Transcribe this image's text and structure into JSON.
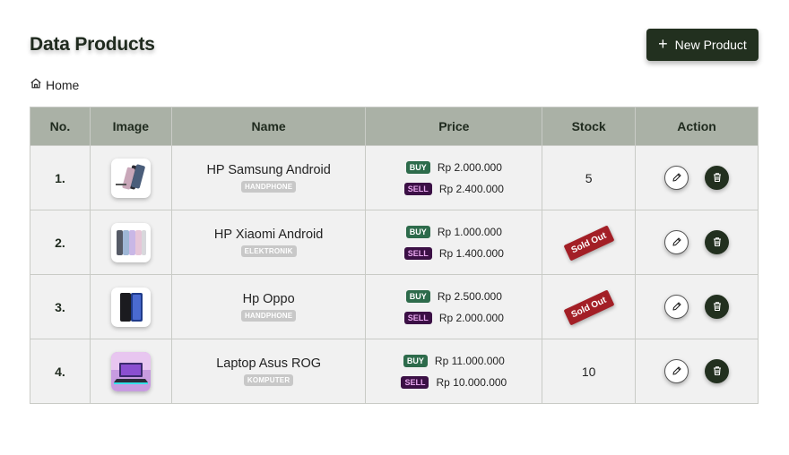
{
  "header": {
    "title": "Data Products",
    "new_button_icon": "plus-icon",
    "new_button_label": "New Product"
  },
  "breadcrumb": {
    "icon": "home-icon",
    "label": "Home"
  },
  "table": {
    "columns": [
      "No.",
      "Image",
      "Name",
      "Price",
      "Stock",
      "Action"
    ],
    "buy_label": "BUY",
    "sell_label": "SELL",
    "rows": [
      {
        "no": "1.",
        "image": "samsung-phones",
        "name": "HP Samsung Android",
        "category": "HANDPHONE",
        "buy": "Rp 2.000.000",
        "sell": "Rp 2.400.000",
        "stock": "5"
      },
      {
        "no": "2.",
        "image": "xiaomi-phones",
        "name": "HP Xiaomi Android",
        "category": "ELEKTRONIK",
        "buy": "Rp 1.000.000",
        "sell": "Rp 1.400.000",
        "stock": "Sold Out"
      },
      {
        "no": "3.",
        "image": "oppo-phone",
        "name": "Hp Oppo",
        "category": "HANDPHONE",
        "buy": "Rp 2.500.000",
        "sell": "Rp 2.000.000",
        "stock": "Sold Out"
      },
      {
        "no": "4.",
        "image": "asus-laptop",
        "name": "Laptop Asus ROG",
        "category": "KOMPUTER",
        "buy": "Rp 11.000.000",
        "sell": "Rp 10.000.000",
        "stock": "10"
      }
    ]
  },
  "colors": {
    "primary": "#22301f",
    "header_bg": "#aab1a6",
    "buy_badge": "#2d6b4b",
    "sell_badge": "#3b1045",
    "sold_out": "#a31f26"
  }
}
